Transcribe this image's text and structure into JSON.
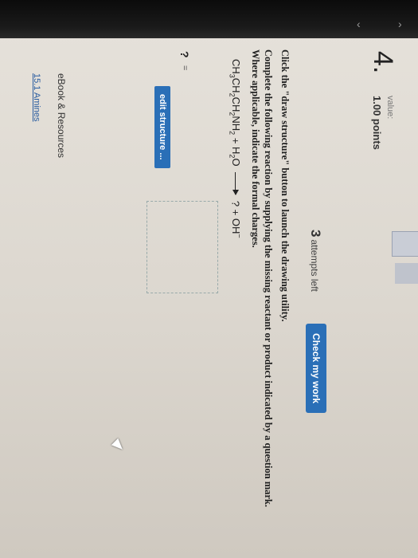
{
  "question": {
    "number": "4.",
    "value_label": "value:",
    "points": "1.00 points"
  },
  "attempts": {
    "count": "3",
    "label": "attempts left"
  },
  "check_button": "Check my work",
  "instructions": {
    "line1": "Click the \"draw structure\" button to launch the drawing utility.",
    "line2": "Complete the following reaction by supplying the missing reactant or product indicated by a question mark. Where applicable, indicate the formal charges."
  },
  "equation": {
    "reactant_a": "CH3CH2CH2NH2",
    "plus1": "+",
    "reactant_b": "H2O",
    "product": "? +",
    "product_ion": "OH−"
  },
  "answer": {
    "question_mark": "?",
    "equals": "=",
    "edit_button": "edit structure ..."
  },
  "resources": {
    "heading": "eBook & Resources",
    "link": "15.1 Amines"
  },
  "colors": {
    "button_blue": "#2a6fb7",
    "link_blue": "#2a5da0"
  }
}
